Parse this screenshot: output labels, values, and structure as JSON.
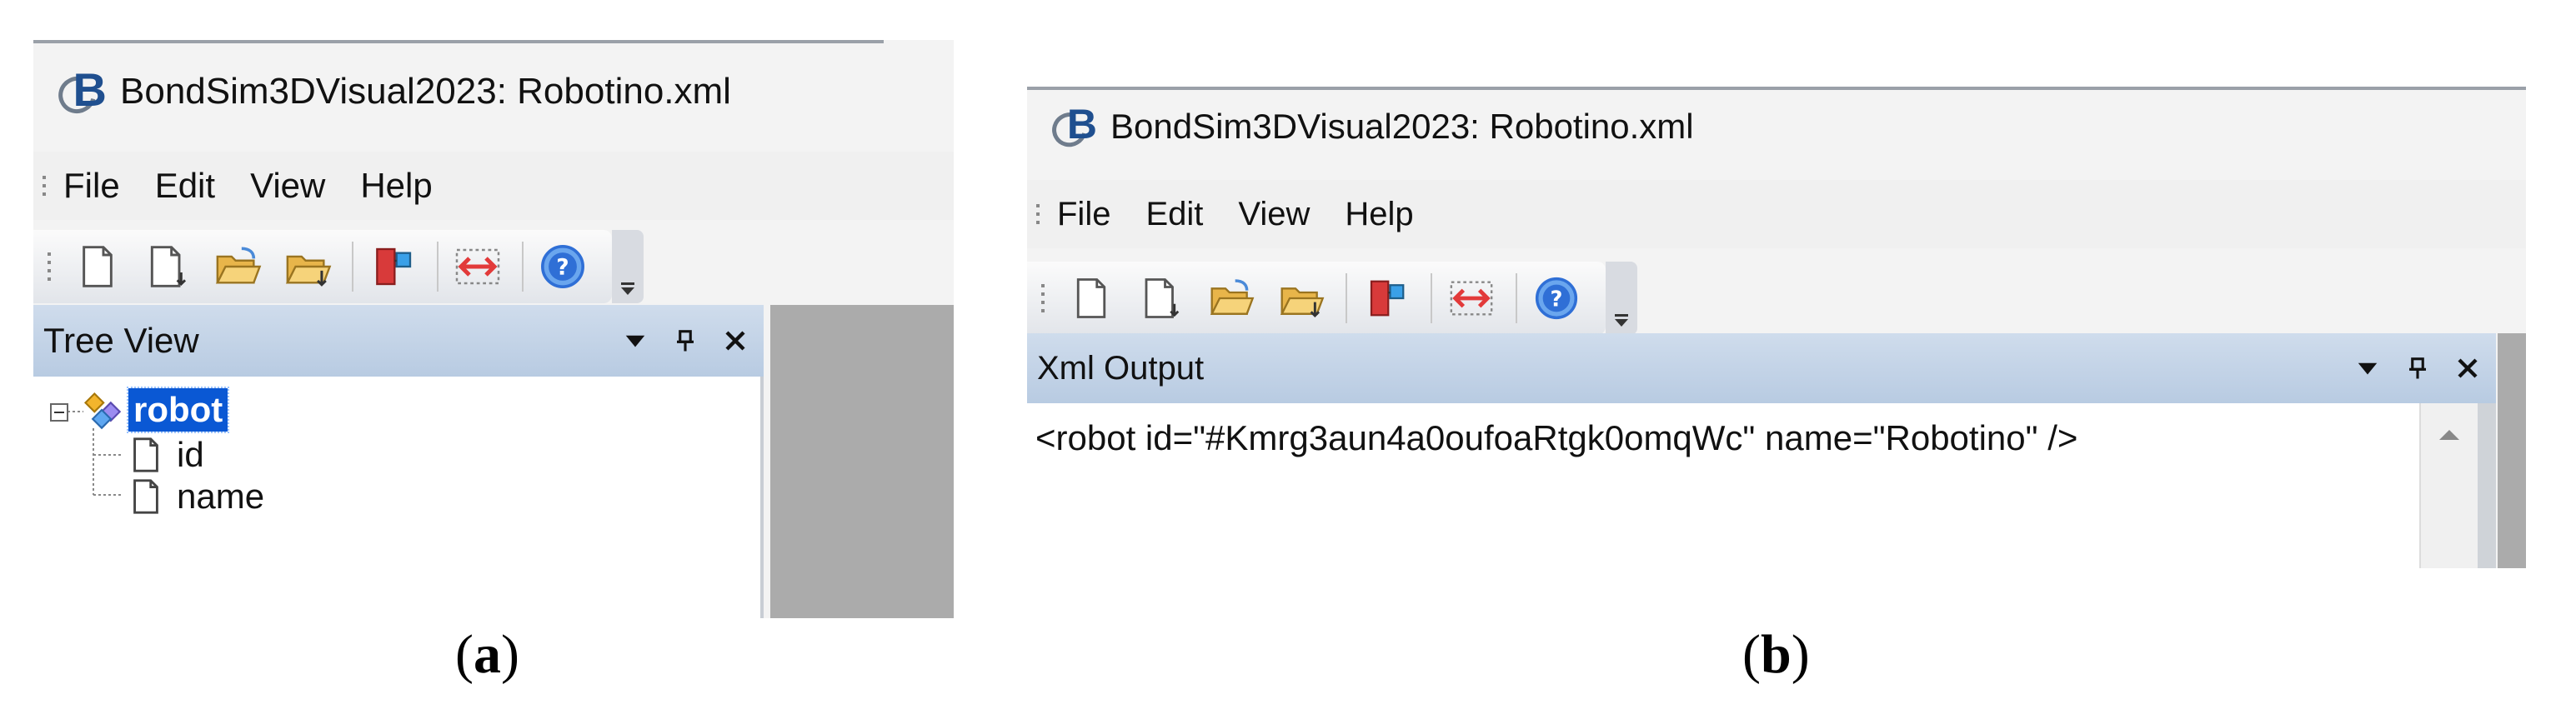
{
  "panel_a": {
    "window_title": "BondSim3DVisual2023: Robotino.xml",
    "logo_letter": "B",
    "menu": [
      "File",
      "Edit",
      "View",
      "Help"
    ],
    "toolbar_icons": [
      "new-document-icon",
      "new-document-add-icon",
      "open-folder-icon",
      "open-recent-folder-icon",
      "model-component-icon",
      "connector-arrow-icon",
      "help-icon"
    ],
    "dock": {
      "title": "Tree View"
    },
    "tree": {
      "root": "robot",
      "children": [
        "id",
        "name"
      ]
    },
    "caption_letter": "a"
  },
  "panel_b": {
    "window_title": "BondSim3DVisual2023: Robotino.xml",
    "logo_letter": "B",
    "menu": [
      "File",
      "Edit",
      "View",
      "Help"
    ],
    "toolbar_icons": [
      "new-document-icon",
      "new-document-add-icon",
      "open-folder-icon",
      "open-recent-folder-icon",
      "model-component-icon",
      "connector-arrow-icon",
      "help-icon"
    ],
    "dock": {
      "title": "Xml Output"
    },
    "xml_output": "<robot id=\"#Kmrg3aun4a0oufoaRtgk0omqWc\" name=\"Robotino\" />",
    "caption_letter": "b"
  },
  "colors": {
    "selection": "#0a58d4",
    "dock_header": "#c4d4e8",
    "connector_red": "#e23a3a",
    "help_blue": "#2f6fd6"
  }
}
